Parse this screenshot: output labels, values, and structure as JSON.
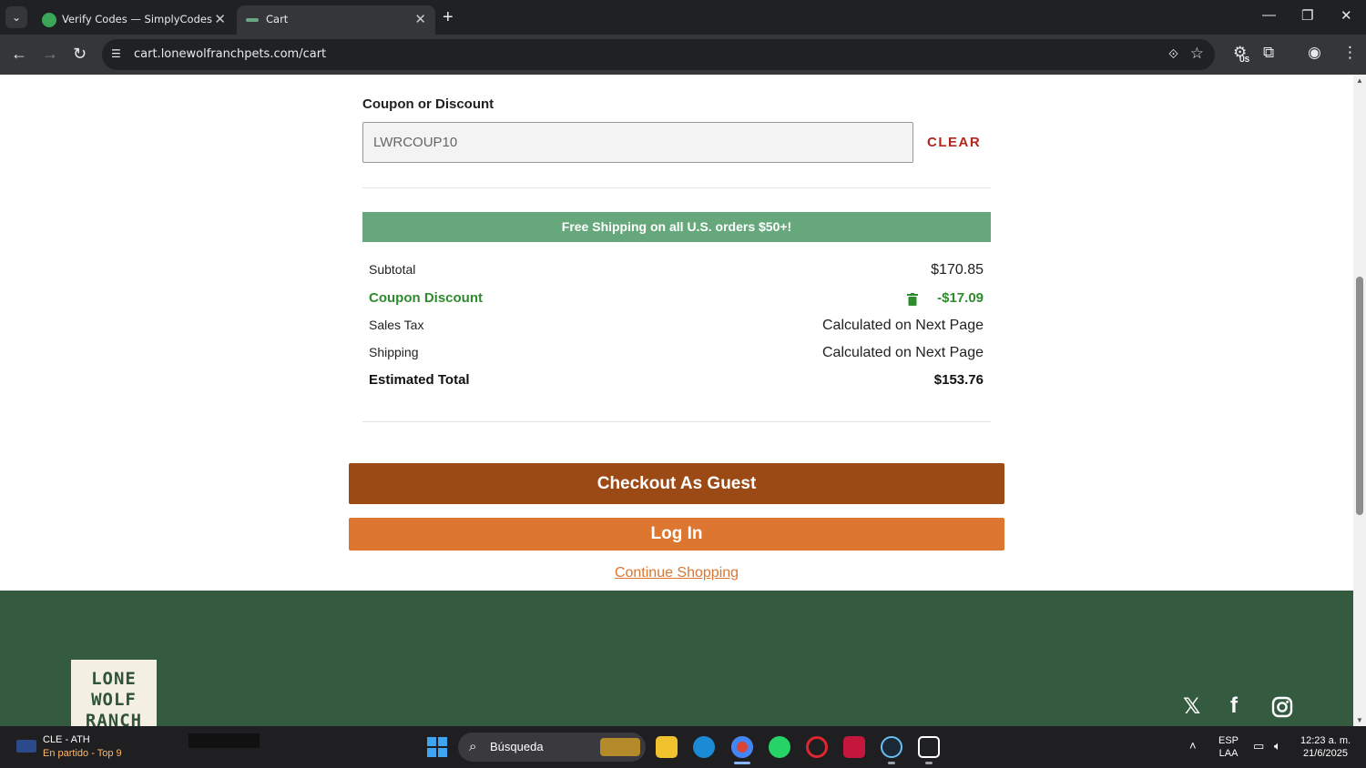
{
  "browser": {
    "tabs": [
      {
        "title": "Verify Codes — SimplyCodes",
        "active": false
      },
      {
        "title": "Cart",
        "active": true
      }
    ],
    "url": "cart.lonewolfranchpets.com/cart",
    "new_tab": "+",
    "extension_badge": "US"
  },
  "cart": {
    "coupon_label": "Coupon or Discount",
    "coupon_value": "LWRCOUP10",
    "clear_label": "CLEAR",
    "promo_banner": "Free Shipping on all U.S. orders $50+!",
    "summary": {
      "subtotal_label": "Subtotal",
      "subtotal_value": "$170.85",
      "discount_label": "Coupon Discount",
      "discount_value": "-$17.09",
      "tax_label": "Sales Tax",
      "tax_value": "Calculated on Next Page",
      "shipping_label": "Shipping",
      "shipping_value": "Calculated on Next Page",
      "total_label": "Estimated Total",
      "total_value": "$153.76"
    },
    "checkout_guest_label": "Checkout As Guest",
    "login_label": "Log In",
    "continue_label": "Continue Shopping"
  },
  "footer": {
    "logo_line1": "LONE",
    "logo_line2": "WOLF",
    "logo_line3": "RANCH",
    "social": [
      "x-icon",
      "facebook-icon",
      "instagram-icon"
    ]
  },
  "taskbar": {
    "weather_title": "CLE - ATH",
    "weather_sub": "En partido - Top 9",
    "search_placeholder": "Búsqueda",
    "lang_line1": "ESP",
    "lang_line2": "LAA",
    "time": "12:23 a. m.",
    "date": "21/6/2025"
  },
  "colors": {
    "promo_green": "#66a87c",
    "discount_green": "#2e8b2e",
    "clear_red": "#b3261e",
    "guest_button": "#9c4a15",
    "login_button": "#dc7630",
    "footer_green": "#345b3f"
  }
}
